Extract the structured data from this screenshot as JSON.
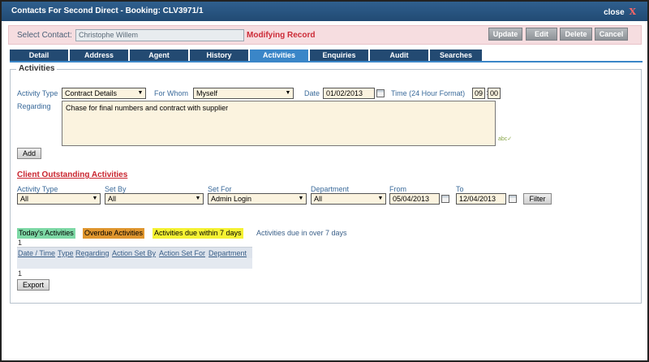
{
  "window": {
    "title": "Contacts For Second Direct - Booking: CLV3971/1",
    "close_label": "close",
    "close_glyph": "X"
  },
  "contact": {
    "label": "Select Contact:",
    "value": "Christophe Willem",
    "status": "Modifying Record"
  },
  "toolbar": {
    "update": "Update",
    "edit": "Edit",
    "delete": "Delete",
    "cancel": "Cancel"
  },
  "tabs": [
    "Detail",
    "Address",
    "Agent",
    "History",
    "Activities",
    "Enquiries",
    "Audit",
    "Searches"
  ],
  "active_tab": "Activities",
  "activity_form": {
    "legend": "Activities",
    "activity_type_label": "Activity Type",
    "activity_type_value": "Contract Details",
    "for_whom_label": "For Whom",
    "for_whom_value": "Myself",
    "date_label": "Date",
    "date_value": "01/02/2013",
    "time_label": "Time (24 Hour Format)",
    "time_hour": "09",
    "time_min": "00",
    "regarding_label": "Regarding",
    "regarding_value": "Chase for final numbers and contract with supplier",
    "add_button": "Add"
  },
  "outstanding": {
    "title": "Client Outstanding Activities",
    "filters": {
      "activity_type_label": "Activity Type",
      "activity_type_value": "All",
      "set_by_label": "Set By",
      "set_by_value": "All",
      "set_for_label": "Set For",
      "set_for_value": "Admin Login",
      "department_label": "Department",
      "department_value": "All",
      "from_label": "From",
      "from_value": "05/04/2013",
      "to_label": "To",
      "to_value": "12/04/2013",
      "filter_button": "Filter"
    },
    "legend": {
      "today": "Today's Activities",
      "overdue": "Overdue Activities",
      "due7": "Activities due within 7 days",
      "over7": "Activities due in over 7 days"
    },
    "legend_colors": {
      "today": "#7ed9a6",
      "overdue": "#e0962e",
      "due7": "#f5f233",
      "over7": "#ffffff"
    },
    "page_top": "1",
    "columns": [
      "Date / Time",
      "Type",
      "Regarding",
      "Action Set By",
      "Action Set For",
      "Department"
    ],
    "page_bottom": "1",
    "export_button": "Export"
  },
  "icons": {
    "calendar": "calendar-icon",
    "dropdown": "chevron-down-icon",
    "spellcheck": "spellcheck-icon"
  }
}
